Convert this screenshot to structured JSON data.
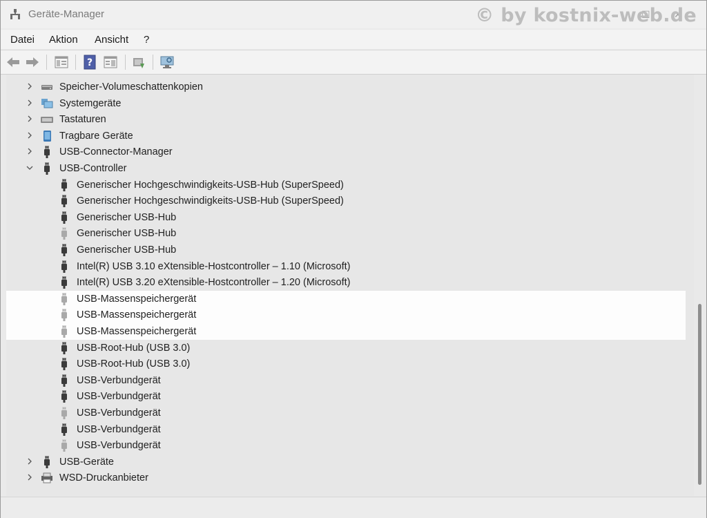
{
  "window": {
    "title": "Geräte-Manager",
    "watermark": "© by kostnix-web.de"
  },
  "menu": [
    "Datei",
    "Aktion",
    "Ansicht",
    "?"
  ],
  "toolbar_icons": [
    "back-arrow-icon",
    "forward-arrow-icon",
    "properties-view-icon",
    "help-icon",
    "details-view-icon",
    "update-driver-icon",
    "scan-hardware-icon"
  ],
  "tree": {
    "categories_top": [
      {
        "label": "Speicher-Volumeschattenkopien",
        "icon": "storage-icon"
      },
      {
        "label": "Systemgeräte",
        "icon": "system-device-icon"
      },
      {
        "label": "Tastaturen",
        "icon": "keyboard-icon"
      },
      {
        "label": "Tragbare Geräte",
        "icon": "portable-device-icon"
      },
      {
        "label": "USB-Connector-Manager",
        "icon": "usb-icon"
      }
    ],
    "expanded": {
      "label": "USB-Controller",
      "icon": "usb-icon"
    },
    "children": [
      {
        "label": "Generischer Hochgeschwindigkeits-USB-Hub (SuperSpeed)",
        "state": "normal"
      },
      {
        "label": "Generischer Hochgeschwindigkeits-USB-Hub (SuperSpeed)",
        "state": "normal"
      },
      {
        "label": "Generischer USB-Hub",
        "state": "normal"
      },
      {
        "label": "Generischer USB-Hub",
        "state": "hidden"
      },
      {
        "label": "Generischer USB-Hub",
        "state": "normal"
      },
      {
        "label": "Intel(R) USB 3.10 eXtensible-Hostcontroller – 1.10 (Microsoft)",
        "state": "normal"
      },
      {
        "label": "Intel(R) USB 3.20 eXtensible-Hostcontroller – 1.20 (Microsoft)",
        "state": "normal"
      },
      {
        "label": "USB-Massenspeichergerät",
        "state": "hidden",
        "highlight": true
      },
      {
        "label": "USB-Massenspeichergerät",
        "state": "hidden",
        "highlight": true
      },
      {
        "label": "USB-Massenspeichergerät",
        "state": "hidden",
        "highlight": true
      },
      {
        "label": "USB-Root-Hub (USB 3.0)",
        "state": "normal"
      },
      {
        "label": "USB-Root-Hub (USB 3.0)",
        "state": "normal"
      },
      {
        "label": "USB-Verbundgerät",
        "state": "normal"
      },
      {
        "label": "USB-Verbundgerät",
        "state": "normal"
      },
      {
        "label": "USB-Verbundgerät",
        "state": "hidden"
      },
      {
        "label": "USB-Verbundgerät",
        "state": "normal"
      },
      {
        "label": "USB-Verbundgerät",
        "state": "hidden"
      }
    ],
    "categories_bottom": [
      {
        "label": "USB-Geräte",
        "icon": "usb-icon"
      },
      {
        "label": "WSD-Druckanbieter",
        "icon": "printer-icon"
      }
    ]
  }
}
